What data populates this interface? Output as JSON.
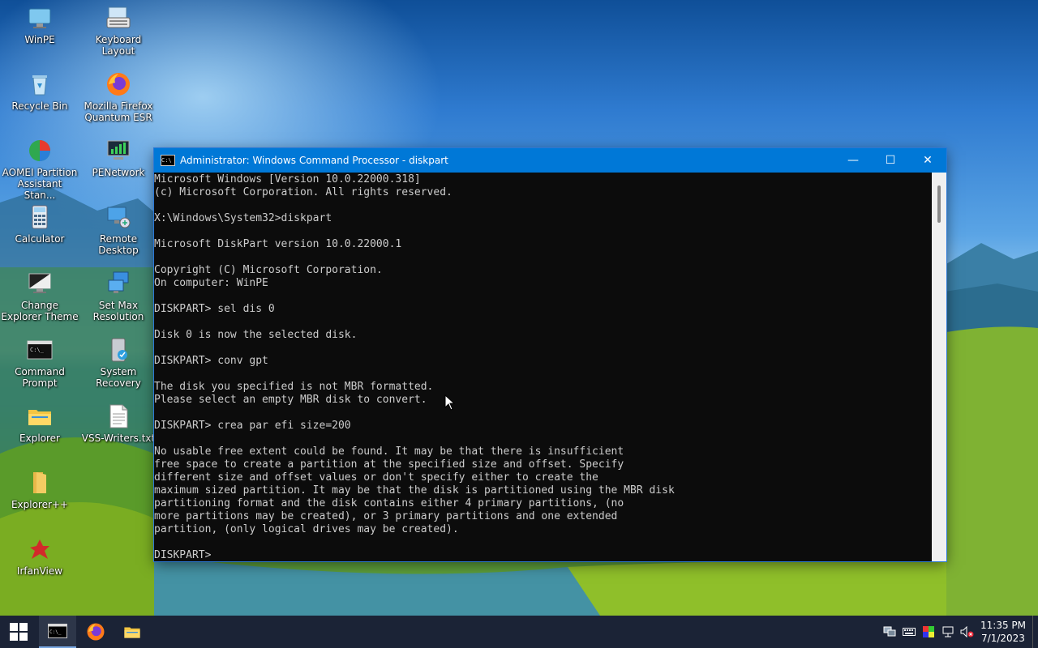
{
  "desktop": {
    "icons": [
      {
        "label": "WinPE",
        "icon": "monitor-icon"
      },
      {
        "label": "Keyboard Layout",
        "icon": "keyboard-icon"
      },
      {
        "label": "Recycle Bin",
        "icon": "recycle-bin-icon"
      },
      {
        "label": "Mozilla Firefox Quantum ESR",
        "icon": "firefox-icon"
      },
      {
        "label": "AOMEI Partition Assistant Stan...",
        "icon": "aomei-icon"
      },
      {
        "label": "PENetwork",
        "icon": "network-icon"
      },
      {
        "label": "Calculator",
        "icon": "calculator-icon"
      },
      {
        "label": "Remote Desktop",
        "icon": "remote-desktop-icon"
      },
      {
        "label": "Change Explorer Theme",
        "icon": "theme-icon"
      },
      {
        "label": "Set Max Resolution",
        "icon": "resolution-icon"
      },
      {
        "label": "Command Prompt",
        "icon": "cmd-icon"
      },
      {
        "label": "System Recovery",
        "icon": "recovery-icon"
      },
      {
        "label": "Explorer",
        "icon": "folder-icon"
      },
      {
        "label": "VSS-Writers.txt",
        "icon": "text-file-icon"
      },
      {
        "label": "Explorer++",
        "icon": "folder-plus-icon"
      },
      {
        "label": "IrfanView",
        "icon": "irfanview-icon"
      }
    ]
  },
  "window": {
    "title": "Administrator: Windows Command Processor - diskpart",
    "minimize": "—",
    "maximize": "☐",
    "close": "✕",
    "console_text": "Microsoft Windows [Version 10.0.22000.318]\n(c) Microsoft Corporation. All rights reserved.\n\nX:\\Windows\\System32>diskpart\n\nMicrosoft DiskPart version 10.0.22000.1\n\nCopyright (C) Microsoft Corporation.\nOn computer: WinPE\n\nDISKPART> sel dis 0\n\nDisk 0 is now the selected disk.\n\nDISKPART> conv gpt\n\nThe disk you specified is not MBR formatted.\nPlease select an empty MBR disk to convert.\n\nDISKPART> crea par efi size=200\n\nNo usable free extent could be found. It may be that there is insufficient\nfree space to create a partition at the specified size and offset. Specify\ndifferent size and offset values or don't specify either to create the\nmaximum sized partition. It may be that the disk is partitioned using the MBR disk\npartitioning format and the disk contains either 4 primary partitions, (no\nmore partitions may be created), or 3 primary partitions and one extended\npartition, (only logical drives may be created).\n\nDISKPART> "
  },
  "taskbar": {
    "time": "11:35 PM",
    "date": "7/1/2023",
    "tray_icons": [
      "network-manager-icon",
      "keyboard-tray-icon",
      "color-icon",
      "network-tray-icon",
      "volume-muted-icon"
    ]
  }
}
